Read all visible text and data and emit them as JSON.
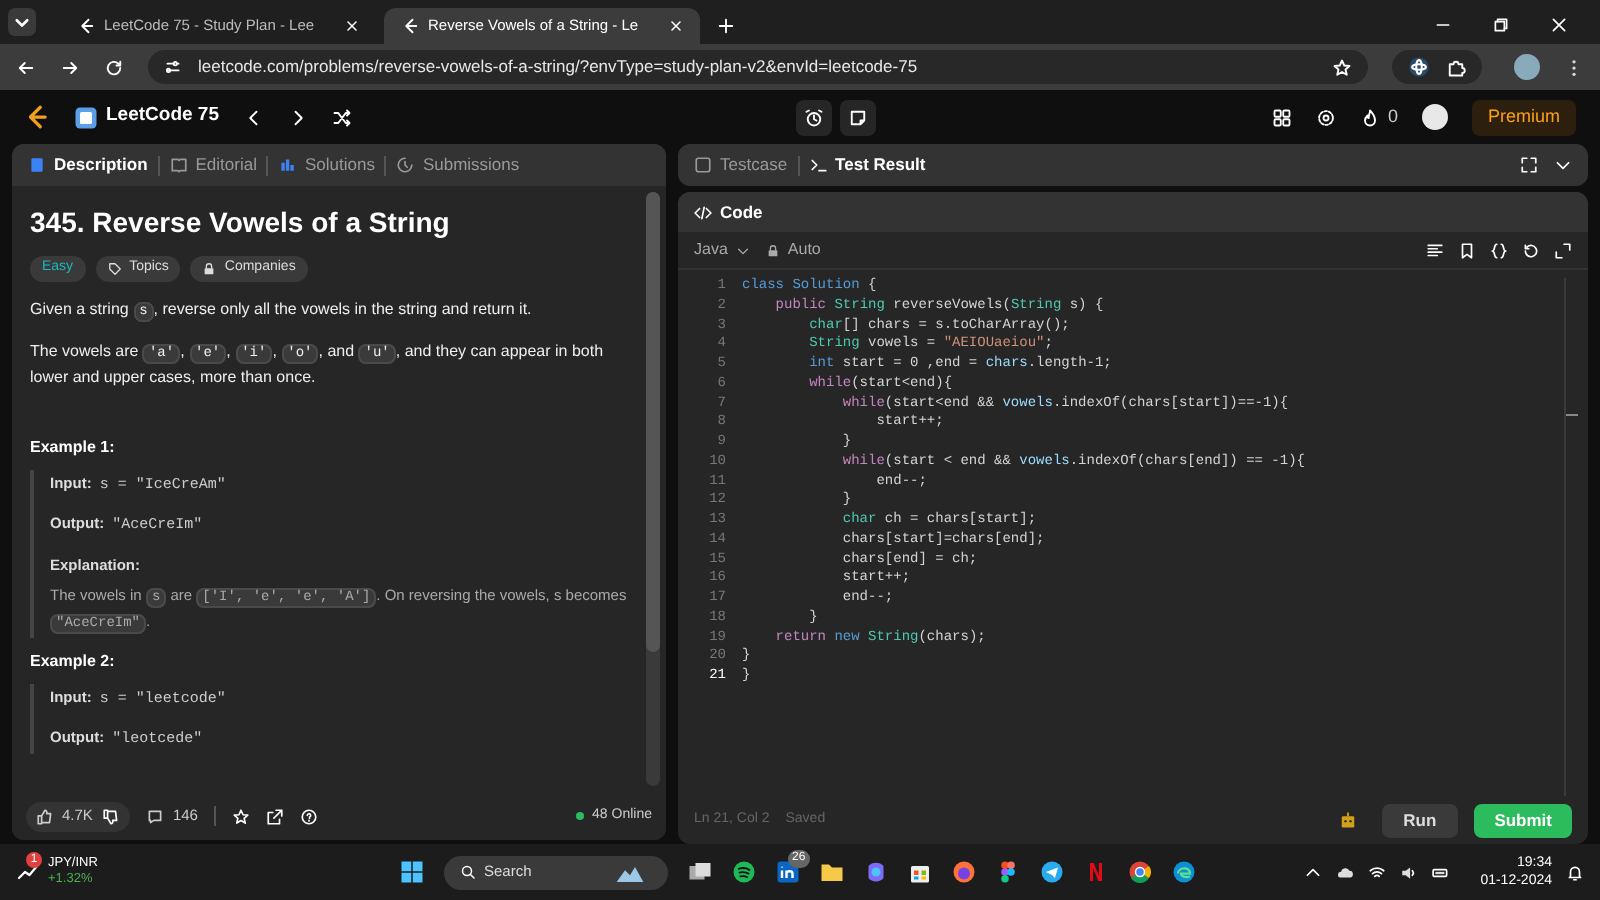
{
  "browser": {
    "tabs": [
      {
        "title": "LeetCode 75 - Study Plan - Lee",
        "selected": false
      },
      {
        "title": "Reverse Vowels of a String - Le",
        "selected": true
      }
    ],
    "url": "leetcode.com/problems/reverse-vowels-of-a-string/?envType=study-plan-v2&envId=leetcode-75"
  },
  "header": {
    "study_plan": "LeetCode 75",
    "streak": "0",
    "premium": "Premium"
  },
  "left_panel": {
    "tabs": [
      {
        "label": "Description",
        "selected": true
      },
      {
        "label": "Editorial",
        "selected": false
      },
      {
        "label": "Solutions",
        "selected": false
      },
      {
        "label": "Submissions",
        "selected": false
      }
    ],
    "title": "345. Reverse Vowels of a String",
    "tags": [
      {
        "label": "Easy",
        "kind": "difficulty"
      },
      {
        "label": "Topics",
        "kind": "topics"
      },
      {
        "label": "Companies",
        "kind": "companies"
      }
    ],
    "paragraphs": [
      [
        {
          "text": "Given a string ",
          "kind": "text"
        },
        {
          "text": "s",
          "kind": "code"
        },
        {
          "text": ", reverse only all the vowels in the string and return it.",
          "kind": "text"
        }
      ],
      [
        {
          "text": "The vowels are ",
          "kind": "text"
        },
        {
          "text": "'a'",
          "kind": "code"
        },
        {
          "text": ", ",
          "kind": "text"
        },
        {
          "text": "'e'",
          "kind": "code"
        },
        {
          "text": ", ",
          "kind": "text"
        },
        {
          "text": "'i'",
          "kind": "code"
        },
        {
          "text": ", ",
          "kind": "text"
        },
        {
          "text": "'o'",
          "kind": "code"
        },
        {
          "text": ", and ",
          "kind": "text"
        },
        {
          "text": "'u'",
          "kind": "code"
        },
        {
          "text": ", and they can appear in both lower and upper cases, more than once.",
          "kind": "text"
        }
      ]
    ],
    "examples": [
      {
        "title": "Example 1:",
        "lines": [
          {
            "label": "Input:",
            "value": "s = \"IceCreAm\""
          },
          {
            "label": "Output:",
            "value": "\"AceCreIm\""
          }
        ],
        "explanation_label": "Explanation:",
        "explanation": [
          {
            "text": "The vowels in ",
            "kind": "text"
          },
          {
            "text": "s",
            "kind": "code"
          },
          {
            "text": " are ",
            "kind": "text"
          },
          {
            "text": "['I', 'e', 'e', 'A']",
            "kind": "code"
          },
          {
            "text": ". On reversing the vowels, s becomes ",
            "kind": "text"
          },
          {
            "text": "\"AceCreIm\"",
            "kind": "code"
          },
          {
            "text": ".",
            "kind": "text"
          }
        ]
      },
      {
        "title": "Example 2:",
        "lines": [
          {
            "label": "Input:",
            "value": "s = \"leetcode\""
          },
          {
            "label": "Output:",
            "value": "\"leotcede\""
          }
        ]
      }
    ],
    "likes": "4.7K",
    "comments": "146",
    "online": "48 Online"
  },
  "right_panel": {
    "tabs": [
      {
        "label": "Testcase",
        "selected": false
      },
      {
        "label": "Test Result",
        "selected": true
      }
    ],
    "code_title": "Code",
    "language": "Java",
    "mode": "Auto",
    "lines": [
      {
        "n": "1",
        "current": false,
        "segments": [
          {
            "t": "class Solution",
            "kind": "decl"
          },
          {
            "t": " {",
            "kind": "plain"
          }
        ]
      },
      {
        "n": "2",
        "current": false,
        "segments": [
          {
            "t": "    public",
            "kind": "kw"
          },
          {
            "t": " String",
            "kind": "type"
          },
          {
            "t": " reverseVowels(",
            "kind": "plain"
          },
          {
            "t": "String",
            "kind": "type"
          },
          {
            "t": " s) {",
            "kind": "plain"
          }
        ]
      },
      {
        "n": "3",
        "current": false,
        "segments": [
          {
            "t": "        char",
            "kind": "type"
          },
          {
            "t": "[] chars = s.toCharArray();",
            "kind": "plain"
          }
        ]
      },
      {
        "n": "4",
        "current": false,
        "segments": [
          {
            "t": "        String",
            "kind": "type"
          },
          {
            "t": " vowels = ",
            "kind": "plain"
          },
          {
            "t": "\"AEIOUaeiou\"",
            "kind": "str"
          },
          {
            "t": ";",
            "kind": "plain"
          }
        ]
      },
      {
        "n": "5",
        "current": false,
        "segments": [
          {
            "t": "        int",
            "kind": "decl"
          },
          {
            "t": " start = 0 ,end = ",
            "kind": "plain"
          },
          {
            "t": "chars",
            "kind": "var"
          },
          {
            "t": ".length-1;",
            "kind": "plain"
          }
        ]
      },
      {
        "n": "6",
        "current": false,
        "segments": [
          {
            "t": "        while",
            "kind": "kw"
          },
          {
            "t": "(start<end){",
            "kind": "plain"
          }
        ]
      },
      {
        "n": "7",
        "current": false,
        "segments": [
          {
            "t": "            while",
            "kind": "kw"
          },
          {
            "t": "(start<end && ",
            "kind": "plain"
          },
          {
            "t": "vowels",
            "kind": "var"
          },
          {
            "t": ".indexOf(chars[start])==-1){",
            "kind": "plain"
          }
        ]
      },
      {
        "n": "8",
        "current": false,
        "segments": [
          {
            "t": "                start++;",
            "kind": "plain"
          }
        ]
      },
      {
        "n": "9",
        "current": false,
        "segments": [
          {
            "t": "            }",
            "kind": "plain"
          }
        ]
      },
      {
        "n": "10",
        "current": false,
        "segments": [
          {
            "t": "            while",
            "kind": "kw"
          },
          {
            "t": "(start < end && ",
            "kind": "plain"
          },
          {
            "t": "vowels",
            "kind": "var"
          },
          {
            "t": ".indexOf(chars[end]) == -1){",
            "kind": "plain"
          }
        ]
      },
      {
        "n": "11",
        "current": false,
        "segments": [
          {
            "t": "                end--;",
            "kind": "plain"
          }
        ]
      },
      {
        "n": "12",
        "current": false,
        "segments": [
          {
            "t": "            }",
            "kind": "plain"
          }
        ]
      },
      {
        "n": "13",
        "current": false,
        "segments": [
          {
            "t": "            char",
            "kind": "type"
          },
          {
            "t": " ch = chars[start];",
            "kind": "plain"
          }
        ]
      },
      {
        "n": "14",
        "current": false,
        "segments": [
          {
            "t": "            chars[start]=chars[end];",
            "kind": "plain"
          }
        ]
      },
      {
        "n": "15",
        "current": false,
        "segments": [
          {
            "t": "            chars[end] = ch;",
            "kind": "plain"
          }
        ]
      },
      {
        "n": "16",
        "current": false,
        "segments": [
          {
            "t": "            start++;",
            "kind": "plain"
          }
        ]
      },
      {
        "n": "17",
        "current": false,
        "segments": [
          {
            "t": "            end--;",
            "kind": "plain"
          }
        ]
      },
      {
        "n": "18",
        "current": false,
        "segments": [
          {
            "t": "        }",
            "kind": "plain"
          }
        ]
      },
      {
        "n": "19",
        "current": false,
        "segments": [
          {
            "t": "    return",
            "kind": "kw"
          },
          {
            "t": " new",
            "kind": "decl"
          },
          {
            "t": " String",
            "kind": "type"
          },
          {
            "t": "(chars);",
            "kind": "plain"
          }
        ]
      },
      {
        "n": "20",
        "current": false,
        "segments": [
          {
            "t": "}",
            "kind": "plain"
          }
        ]
      },
      {
        "n": "21",
        "current": true,
        "segments": [
          {
            "t": "}",
            "kind": "plain"
          }
        ]
      }
    ],
    "cursor": "Ln 21, Col 2",
    "save_state": "Saved",
    "run": "Run",
    "submit": "Submit"
  },
  "taskbar": {
    "ticker": "JPY/INR",
    "change": "+1.32%",
    "widget_badge": "1",
    "search": "Search",
    "linkedin_badge": "26",
    "time": "19:34",
    "date": "01-12-2024"
  }
}
